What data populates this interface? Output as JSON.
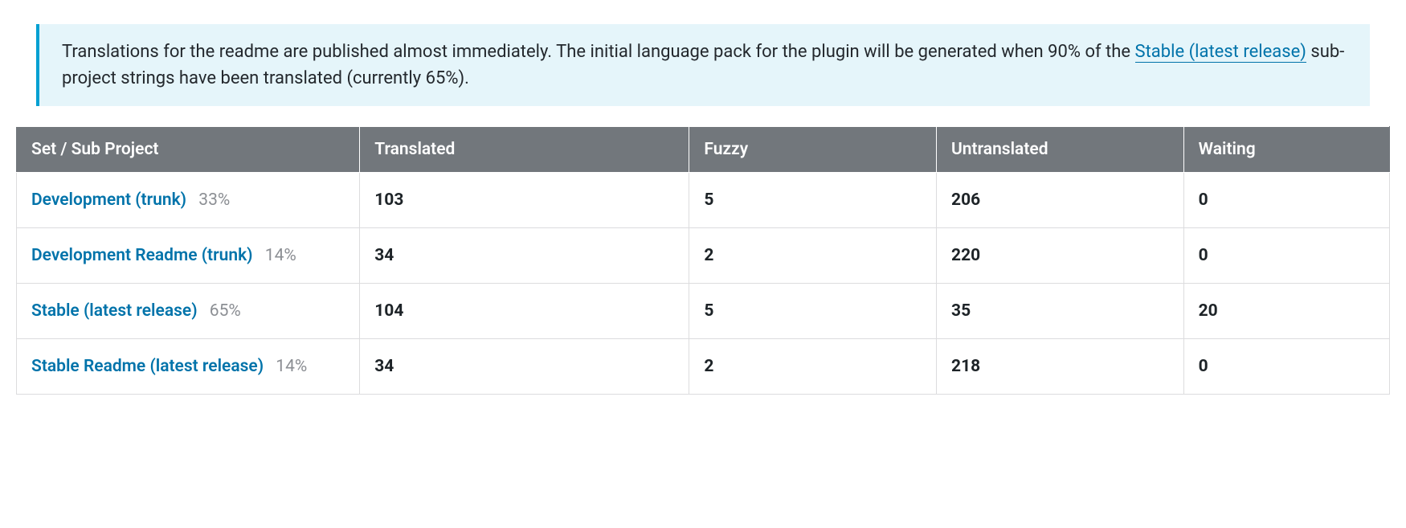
{
  "notice": {
    "text_before_link": "Translations for the readme are published almost immediately. The initial language pack for the plugin will be generated when 90% of the ",
    "link_text": "Stable (latest release)",
    "text_after_link": " sub-project strings have been translated (currently 65%)."
  },
  "table": {
    "columns": {
      "set": "Set / Sub Project",
      "translated": "Translated",
      "fuzzy": "Fuzzy",
      "untranslated": "Untranslated",
      "waiting": "Waiting"
    },
    "rows": [
      {
        "name": "Development (trunk)",
        "percent": "33%",
        "translated": "103",
        "fuzzy": "5",
        "untranslated": "206",
        "waiting": "0"
      },
      {
        "name": "Development Readme (trunk)",
        "percent": "14%",
        "translated": "34",
        "fuzzy": "2",
        "untranslated": "220",
        "waiting": "0"
      },
      {
        "name": "Stable (latest release)",
        "percent": "65%",
        "translated": "104",
        "fuzzy": "5",
        "untranslated": "35",
        "waiting": "20"
      },
      {
        "name": "Stable Readme (latest release)",
        "percent": "14%",
        "translated": "34",
        "fuzzy": "2",
        "untranslated": "218",
        "waiting": "0"
      }
    ]
  },
  "chart_data": {
    "type": "table",
    "columns": [
      "Set / Sub Project",
      "Percent",
      "Translated",
      "Fuzzy",
      "Untranslated",
      "Waiting"
    ],
    "rows": [
      [
        "Development (trunk)",
        33,
        103,
        5,
        206,
        0
      ],
      [
        "Development Readme (trunk)",
        14,
        34,
        2,
        220,
        0
      ],
      [
        "Stable (latest release)",
        65,
        104,
        5,
        35,
        20
      ],
      [
        "Stable Readme (latest release)",
        14,
        34,
        2,
        218,
        0
      ]
    ]
  }
}
